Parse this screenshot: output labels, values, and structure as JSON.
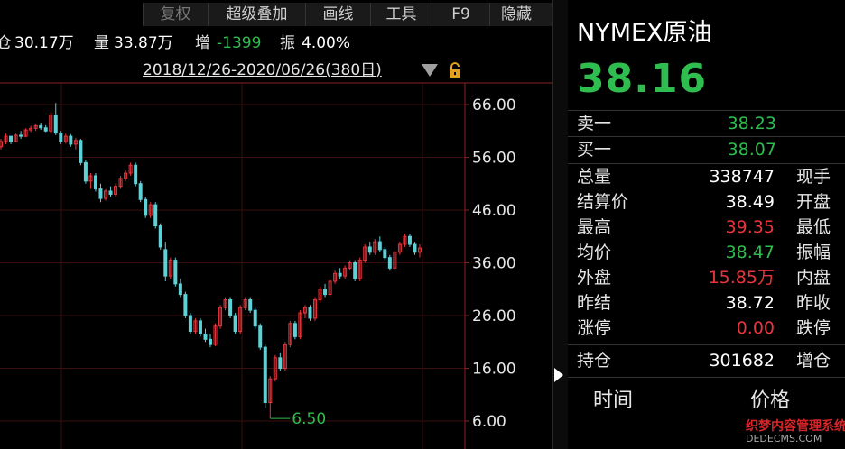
{
  "toolbar": {
    "items": [
      "复权",
      "超级叠加",
      "画线",
      "工具",
      "F9",
      "隐藏"
    ]
  },
  "infobar": {
    "position_label": "仓",
    "position_value": "30.17万",
    "volume_label": "量",
    "volume_value": "33.87万",
    "change_label": "增",
    "change_value": "-1399",
    "amplitude_label": "振",
    "amplitude_value": "4.00%"
  },
  "chart": {
    "date_range": "2018/12/26-2020/06/26(380日)",
    "y_ticks": [
      "66.00",
      "56.00",
      "46.00",
      "36.00",
      "26.00",
      "16.00",
      "6.00"
    ],
    "low_marker": "6.50",
    "colors": {
      "up": "#e8353c",
      "down": "#5ed0d6",
      "axis": "#8a1f1f",
      "grid": "#3a0f0f"
    }
  },
  "chart_data": {
    "type": "candlestick",
    "y_range": [
      6.0,
      66.0
    ],
    "axis_labels": [
      "66.00",
      "56.00",
      "46.00",
      "36.00",
      "26.00",
      "16.00",
      "6.00"
    ],
    "min_label": "6.50",
    "bars": [
      [
        58,
        59.5,
        57.5,
        59
      ],
      [
        59,
        60.5,
        58.5,
        60
      ],
      [
        60,
        60,
        58.5,
        59
      ],
      [
        59,
        60.5,
        58.8,
        60.2
      ],
      [
        60.2,
        61,
        59.5,
        60
      ],
      [
        60,
        61.5,
        59.8,
        61.2
      ],
      [
        61.2,
        62,
        60.8,
        61.5
      ],
      [
        61.5,
        62.3,
        61,
        62
      ],
      [
        62,
        62.6,
        61.2,
        61.6
      ],
      [
        61.6,
        62.1,
        60.8,
        61
      ],
      [
        61,
        64.5,
        60.5,
        64
      ],
      [
        64,
        66.3,
        60.2,
        60.6
      ],
      [
        60.6,
        61,
        58.5,
        59
      ],
      [
        59,
        60.5,
        58.6,
        60
      ],
      [
        60,
        60.4,
        58,
        58.5
      ],
      [
        58.5,
        59.7,
        57.5,
        59.2
      ],
      [
        59.2,
        59.5,
        54.5,
        55
      ],
      [
        55,
        55.5,
        51,
        51.5
      ],
      [
        51.5,
        53,
        50,
        52.5
      ],
      [
        52.5,
        53,
        49.5,
        50
      ],
      [
        50,
        51,
        47.5,
        48.2
      ],
      [
        48.2,
        50,
        47.8,
        49.6
      ],
      [
        49.6,
        50.5,
        48.5,
        49
      ],
      [
        49,
        51,
        48.6,
        50.5
      ],
      [
        50.5,
        52.5,
        50,
        52
      ],
      [
        52,
        53.5,
        51.5,
        53
      ],
      [
        53,
        55,
        52.5,
        54.5
      ],
      [
        54.5,
        55,
        50.5,
        51
      ],
      [
        51,
        51.5,
        47.5,
        48
      ],
      [
        48,
        48.5,
        44.5,
        45
      ],
      [
        45,
        47.5,
        44.5,
        47
      ],
      [
        47,
        47.5,
        42.5,
        43
      ],
      [
        43,
        43.5,
        38.5,
        39
      ],
      [
        38.5,
        40,
        32.5,
        33.5
      ],
      [
        33.5,
        37,
        33,
        36.5
      ],
      [
        36.5,
        37,
        31.5,
        32
      ],
      [
        32,
        33,
        29.5,
        30
      ],
      [
        30,
        30.5,
        25.5,
        26
      ],
      [
        26,
        26.5,
        22.5,
        23
      ],
      [
        23,
        25.5,
        22.5,
        25
      ],
      [
        25,
        25.5,
        22,
        22.5
      ],
      [
        22.5,
        23.5,
        21,
        21.5
      ],
      [
        21.5,
        22.5,
        20,
        20.5
      ],
      [
        20.5,
        24.5,
        20.2,
        24
      ],
      [
        24,
        28,
        23.5,
        27.5
      ],
      [
        27.5,
        29.5,
        27,
        29
      ],
      [
        29,
        29.5,
        25.5,
        26
      ],
      [
        26,
        26.5,
        22.5,
        23
      ],
      [
        23,
        28,
        22.5,
        27.5
      ],
      [
        27.5,
        29.5,
        27,
        29
      ],
      [
        29,
        29.5,
        26.5,
        27
      ],
      [
        27,
        27.5,
        23.5,
        24
      ],
      [
        24,
        24.5,
        19.5,
        20
      ],
      [
        20,
        20.5,
        8.5,
        9.5
      ],
      [
        9.5,
        14.5,
        6.5,
        14
      ],
      [
        14,
        18.5,
        13.5,
        18
      ],
      [
        18,
        19,
        15.5,
        16
      ],
      [
        16,
        21,
        15.5,
        20.5
      ],
      [
        20.5,
        25,
        20,
        24.5
      ],
      [
        24.5,
        25,
        21.5,
        22
      ],
      [
        22,
        27,
        21.5,
        26.5
      ],
      [
        26.5,
        28,
        25.5,
        27.5
      ],
      [
        27.5,
        28,
        25,
        25.5
      ],
      [
        25.5,
        29.5,
        25,
        29
      ],
      [
        29,
        31.5,
        28.5,
        31
      ],
      [
        31,
        32,
        29.5,
        30
      ],
      [
        30,
        33,
        29.5,
        32.5
      ],
      [
        32.5,
        34.5,
        32,
        34
      ],
      [
        34,
        35,
        33,
        33.5
      ],
      [
        33.5,
        35.5,
        33,
        35
      ],
      [
        35,
        36.5,
        34.5,
        36
      ],
      [
        36,
        36.5,
        32.5,
        33
      ],
      [
        33,
        37,
        32.5,
        36.5
      ],
      [
        36.5,
        39.5,
        36,
        39
      ],
      [
        39,
        40,
        37.5,
        38
      ],
      [
        38,
        40.5,
        37.5,
        40
      ],
      [
        40,
        41,
        38,
        38.5
      ],
      [
        38.5,
        39,
        36.5,
        37
      ],
      [
        37,
        37.5,
        34.5,
        35
      ],
      [
        35,
        38.5,
        34.5,
        38
      ],
      [
        38,
        40,
        37.5,
        39.5
      ],
      [
        39.5,
        41.5,
        39,
        41
      ],
      [
        41,
        41.5,
        39,
        39.5
      ],
      [
        39.5,
        40,
        37.5,
        38
      ],
      [
        38,
        39.5,
        37,
        38.8
      ]
    ]
  },
  "quote": {
    "title": "NYMEX原油",
    "price": "38.16",
    "sell_label": "卖一",
    "sell_value": "38.23",
    "buy_label": "买一",
    "buy_value": "38.07",
    "rows": [
      {
        "label": "总量",
        "value": "338747",
        "label2": "现手",
        "color": "white"
      },
      {
        "label": "结算价",
        "value": "38.49",
        "label2": "开盘",
        "color": "white"
      },
      {
        "label": "最高",
        "value": "39.35",
        "label2": "最低",
        "color": "red"
      },
      {
        "label": "均价",
        "value": "38.47",
        "label2": "振幅",
        "color": "green"
      },
      {
        "label": "外盘",
        "value": "15.85万",
        "label2": "内盘",
        "color": "red"
      },
      {
        "label": "昨结",
        "value": "38.72",
        "label2": "昨收",
        "color": "white"
      },
      {
        "label": "涨停",
        "value": "0.00",
        "label2": "跌停",
        "color": "red"
      }
    ],
    "open_interest_label": "持仓",
    "open_interest_value": "301682",
    "open_interest_label2": "增仓",
    "col_time": "时间",
    "col_price": "价格"
  },
  "watermark": {
    "line1": "织梦内容管理系统",
    "line2": "DEDECMS.COM"
  }
}
